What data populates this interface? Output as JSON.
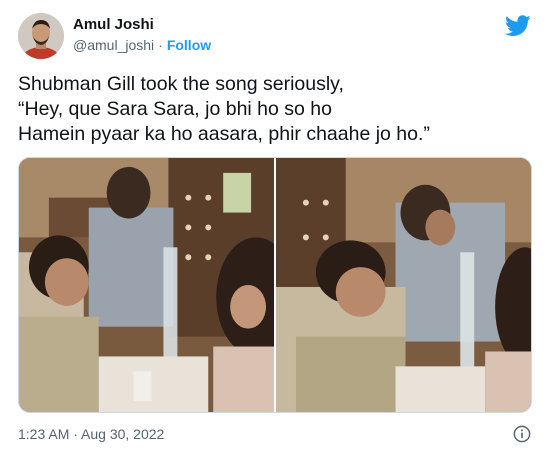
{
  "author": {
    "name": "Amul Joshi",
    "handle": "@amul_joshi",
    "separator": "·",
    "follow_label": "Follow"
  },
  "tweet": {
    "lines": [
      "Shubman Gill took the song seriously,",
      "“Hey, que Sara Sara, jo bhi ho so ho",
      "Hamein pyaar ka ho aasara, phir chaahe jo ho.”"
    ]
  },
  "meta": {
    "timestamp": "1:23 AM · Aug 30, 2022"
  },
  "icons": {
    "brand": "twitter-bird-icon",
    "info": "info-icon"
  },
  "colors": {
    "accent": "#1d9bf0",
    "muted": "#536471",
    "text": "#0f1419"
  }
}
